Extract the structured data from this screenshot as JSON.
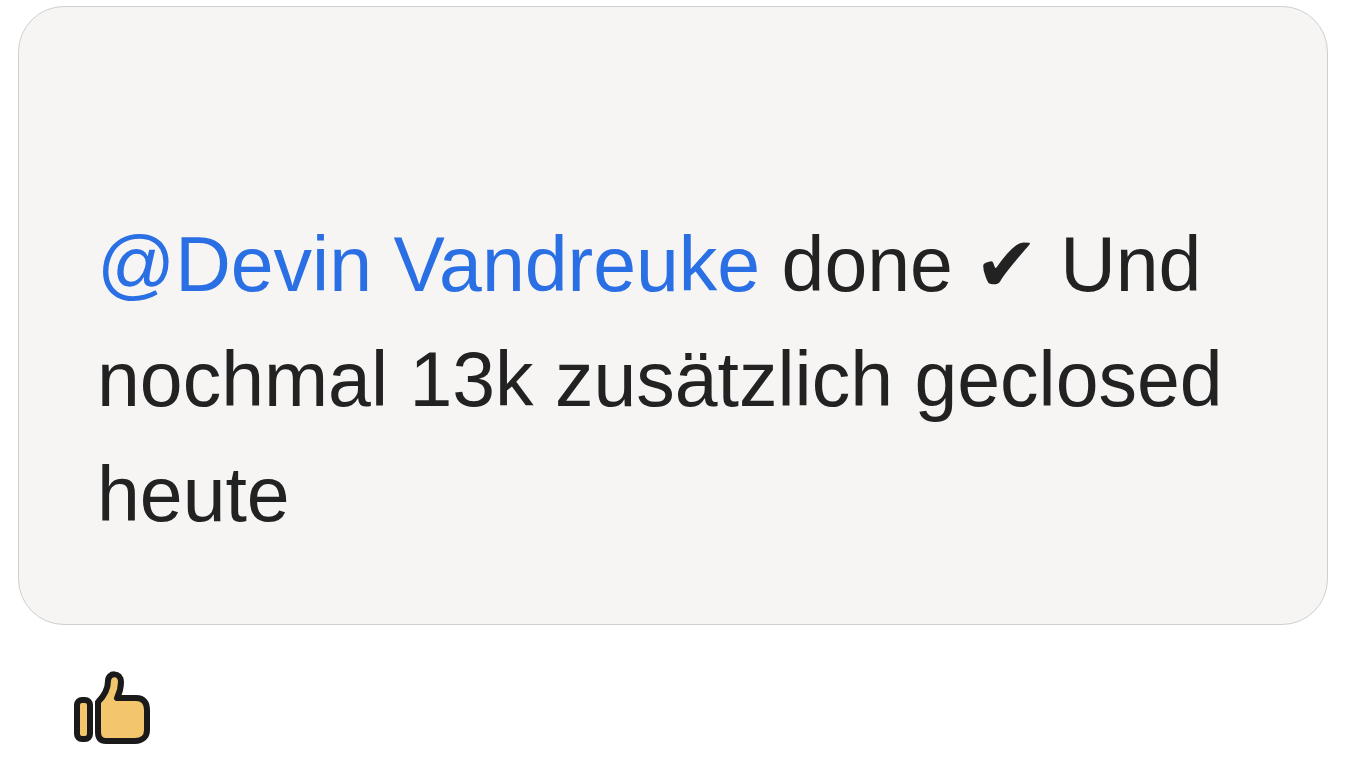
{
  "message": {
    "mention": "@Devin Vandreuke",
    "text": "done ✔ Und nochmal 13k zusätzlich geclosed heute"
  },
  "reactions": [
    {
      "kind": "thumbs_up"
    }
  ]
}
